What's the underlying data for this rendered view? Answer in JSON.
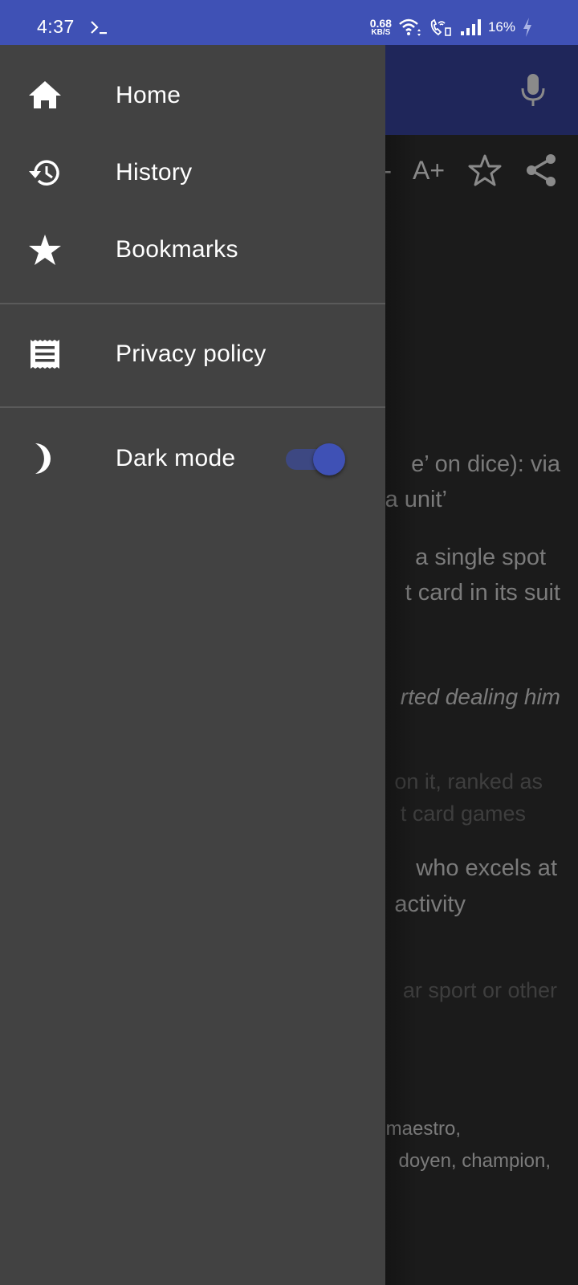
{
  "status_bar": {
    "time": "4:37",
    "terminal_icon": "terminal-prompt-icon",
    "net_speed_value": "0.68",
    "net_speed_unit": "KB/S",
    "wifi_icon": "wifi-icon",
    "wifi_call_icon": "wifi-calling-icon",
    "signal_icon": "cell-signal-icon",
    "battery": "16%",
    "charging_icon": "charging-bolt-icon"
  },
  "background_page": {
    "mic_icon": "microphone-icon",
    "toolbar": {
      "font_decrease_label": "A-",
      "font_increase_label": "A+",
      "bookmark_icon": "star-outline-icon",
      "share_icon": "share-icon"
    },
    "content_lines": [
      {
        "text": "e’ on dice): via",
        "style": "normal"
      },
      {
        "text": "a unit’",
        "style": "normal"
      },
      {
        "text": "a single spot",
        "style": "normal"
      },
      {
        "text": "t card in its suit",
        "style": "normal"
      },
      {
        "text": "rted dealing him",
        "style": "italic"
      },
      {
        "text": "on it, ranked as",
        "style": "dim"
      },
      {
        "text": "t card games",
        "style": "dim"
      },
      {
        "text": "who excels at",
        "style": "normal"
      },
      {
        "text": "activity",
        "style": "normal"
      },
      {
        "text": "ar sport or other",
        "style": "dim"
      },
      {
        "text": "maestro,",
        "style": "small"
      },
      {
        "text": "doyen, champion,",
        "style": "small"
      }
    ]
  },
  "drawer": {
    "items": [
      {
        "label": "Home",
        "icon": "home-icon"
      },
      {
        "label": "History",
        "icon": "history-icon"
      },
      {
        "label": "Bookmarks",
        "icon": "star-icon"
      },
      {
        "label": "Privacy policy",
        "icon": "receipt-icon"
      },
      {
        "label": "Dark mode",
        "icon": "moon-icon"
      }
    ],
    "dark_mode_enabled": true
  },
  "colors": {
    "primary": "#3f51b5",
    "app_bar_dimmed": "#1f265a",
    "drawer_bg": "#424242",
    "page_bg": "#1b1b1b",
    "switch_track": "#3d4882"
  }
}
